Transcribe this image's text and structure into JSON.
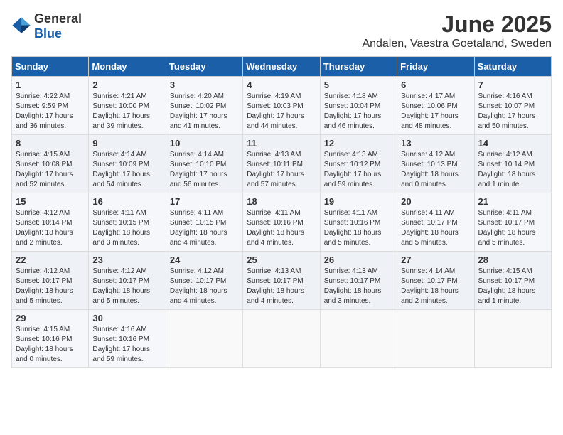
{
  "logo": {
    "general": "General",
    "blue": "Blue"
  },
  "title": "June 2025",
  "location": "Andalen, Vaestra Goetaland, Sweden",
  "weekdays": [
    "Sunday",
    "Monday",
    "Tuesday",
    "Wednesday",
    "Thursday",
    "Friday",
    "Saturday"
  ],
  "weeks": [
    [
      {
        "day": "1",
        "sunrise": "Sunrise: 4:22 AM",
        "sunset": "Sunset: 9:59 PM",
        "daylight": "Daylight: 17 hours and 36 minutes."
      },
      {
        "day": "2",
        "sunrise": "Sunrise: 4:21 AM",
        "sunset": "Sunset: 10:00 PM",
        "daylight": "Daylight: 17 hours and 39 minutes."
      },
      {
        "day": "3",
        "sunrise": "Sunrise: 4:20 AM",
        "sunset": "Sunset: 10:02 PM",
        "daylight": "Daylight: 17 hours and 41 minutes."
      },
      {
        "day": "4",
        "sunrise": "Sunrise: 4:19 AM",
        "sunset": "Sunset: 10:03 PM",
        "daylight": "Daylight: 17 hours and 44 minutes."
      },
      {
        "day": "5",
        "sunrise": "Sunrise: 4:18 AM",
        "sunset": "Sunset: 10:04 PM",
        "daylight": "Daylight: 17 hours and 46 minutes."
      },
      {
        "day": "6",
        "sunrise": "Sunrise: 4:17 AM",
        "sunset": "Sunset: 10:06 PM",
        "daylight": "Daylight: 17 hours and 48 minutes."
      },
      {
        "day": "7",
        "sunrise": "Sunrise: 4:16 AM",
        "sunset": "Sunset: 10:07 PM",
        "daylight": "Daylight: 17 hours and 50 minutes."
      }
    ],
    [
      {
        "day": "8",
        "sunrise": "Sunrise: 4:15 AM",
        "sunset": "Sunset: 10:08 PM",
        "daylight": "Daylight: 17 hours and 52 minutes."
      },
      {
        "day": "9",
        "sunrise": "Sunrise: 4:14 AM",
        "sunset": "Sunset: 10:09 PM",
        "daylight": "Daylight: 17 hours and 54 minutes."
      },
      {
        "day": "10",
        "sunrise": "Sunrise: 4:14 AM",
        "sunset": "Sunset: 10:10 PM",
        "daylight": "Daylight: 17 hours and 56 minutes."
      },
      {
        "day": "11",
        "sunrise": "Sunrise: 4:13 AM",
        "sunset": "Sunset: 10:11 PM",
        "daylight": "Daylight: 17 hours and 57 minutes."
      },
      {
        "day": "12",
        "sunrise": "Sunrise: 4:13 AM",
        "sunset": "Sunset: 10:12 PM",
        "daylight": "Daylight: 17 hours and 59 minutes."
      },
      {
        "day": "13",
        "sunrise": "Sunrise: 4:12 AM",
        "sunset": "Sunset: 10:13 PM",
        "daylight": "Daylight: 18 hours and 0 minutes."
      },
      {
        "day": "14",
        "sunrise": "Sunrise: 4:12 AM",
        "sunset": "Sunset: 10:14 PM",
        "daylight": "Daylight: 18 hours and 1 minute."
      }
    ],
    [
      {
        "day": "15",
        "sunrise": "Sunrise: 4:12 AM",
        "sunset": "Sunset: 10:14 PM",
        "daylight": "Daylight: 18 hours and 2 minutes."
      },
      {
        "day": "16",
        "sunrise": "Sunrise: 4:11 AM",
        "sunset": "Sunset: 10:15 PM",
        "daylight": "Daylight: 18 hours and 3 minutes."
      },
      {
        "day": "17",
        "sunrise": "Sunrise: 4:11 AM",
        "sunset": "Sunset: 10:15 PM",
        "daylight": "Daylight: 18 hours and 4 minutes."
      },
      {
        "day": "18",
        "sunrise": "Sunrise: 4:11 AM",
        "sunset": "Sunset: 10:16 PM",
        "daylight": "Daylight: 18 hours and 4 minutes."
      },
      {
        "day": "19",
        "sunrise": "Sunrise: 4:11 AM",
        "sunset": "Sunset: 10:16 PM",
        "daylight": "Daylight: 18 hours and 5 minutes."
      },
      {
        "day": "20",
        "sunrise": "Sunrise: 4:11 AM",
        "sunset": "Sunset: 10:17 PM",
        "daylight": "Daylight: 18 hours and 5 minutes."
      },
      {
        "day": "21",
        "sunrise": "Sunrise: 4:11 AM",
        "sunset": "Sunset: 10:17 PM",
        "daylight": "Daylight: 18 hours and 5 minutes."
      }
    ],
    [
      {
        "day": "22",
        "sunrise": "Sunrise: 4:12 AM",
        "sunset": "Sunset: 10:17 PM",
        "daylight": "Daylight: 18 hours and 5 minutes."
      },
      {
        "day": "23",
        "sunrise": "Sunrise: 4:12 AM",
        "sunset": "Sunset: 10:17 PM",
        "daylight": "Daylight: 18 hours and 5 minutes."
      },
      {
        "day": "24",
        "sunrise": "Sunrise: 4:12 AM",
        "sunset": "Sunset: 10:17 PM",
        "daylight": "Daylight: 18 hours and 4 minutes."
      },
      {
        "day": "25",
        "sunrise": "Sunrise: 4:13 AM",
        "sunset": "Sunset: 10:17 PM",
        "daylight": "Daylight: 18 hours and 4 minutes."
      },
      {
        "day": "26",
        "sunrise": "Sunrise: 4:13 AM",
        "sunset": "Sunset: 10:17 PM",
        "daylight": "Daylight: 18 hours and 3 minutes."
      },
      {
        "day": "27",
        "sunrise": "Sunrise: 4:14 AM",
        "sunset": "Sunset: 10:17 PM",
        "daylight": "Daylight: 18 hours and 2 minutes."
      },
      {
        "day": "28",
        "sunrise": "Sunrise: 4:15 AM",
        "sunset": "Sunset: 10:17 PM",
        "daylight": "Daylight: 18 hours and 1 minute."
      }
    ],
    [
      {
        "day": "29",
        "sunrise": "Sunrise: 4:15 AM",
        "sunset": "Sunset: 10:16 PM",
        "daylight": "Daylight: 18 hours and 0 minutes."
      },
      {
        "day": "30",
        "sunrise": "Sunrise: 4:16 AM",
        "sunset": "Sunset: 10:16 PM",
        "daylight": "Daylight: 17 hours and 59 minutes."
      },
      null,
      null,
      null,
      null,
      null
    ]
  ]
}
